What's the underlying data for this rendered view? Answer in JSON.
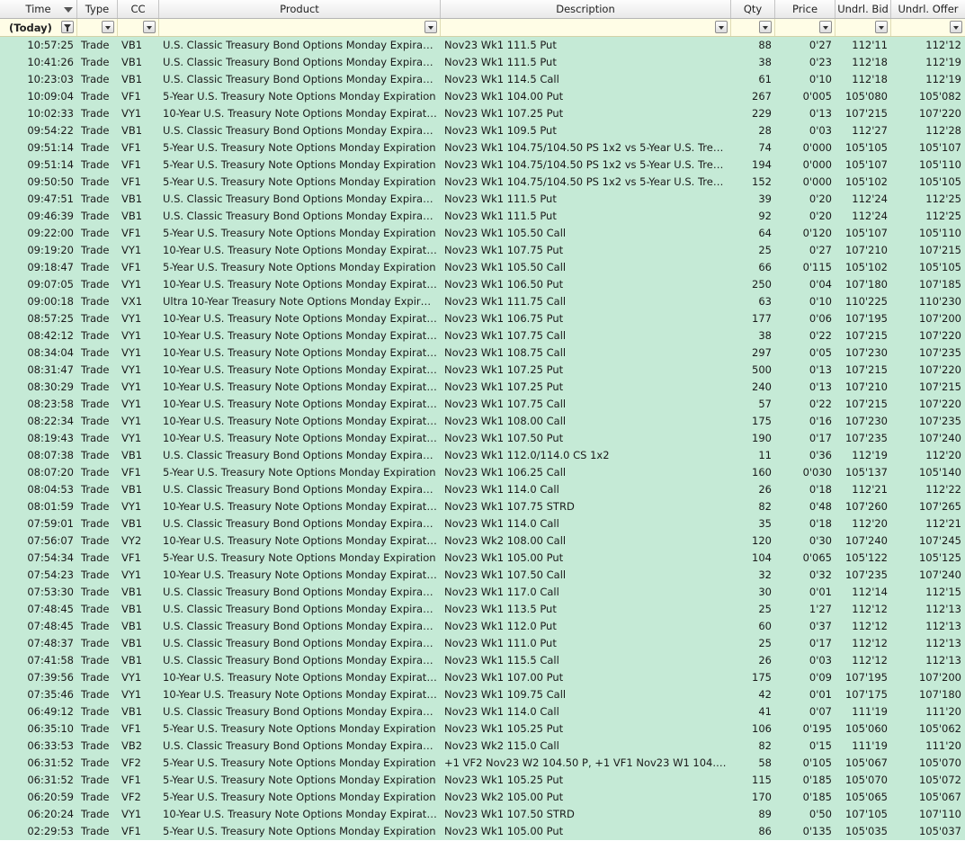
{
  "columns": {
    "time": "Time",
    "type": "Type",
    "cc": "CC",
    "product": "Product",
    "description": "Description",
    "qty": "Qty",
    "price": "Price",
    "undrl_bid": "Undrl. Bid",
    "undrl_offer": "Undrl. Offer"
  },
  "filter": {
    "time": "(Today)"
  },
  "icons": {
    "sort": "sort-descending-icon",
    "filter_dropdown": "chevron-down-icon",
    "filter_active": "funnel-filter-icon"
  },
  "colors": {
    "row_bg": "#c5ead6",
    "filter_bg": "#fffde6"
  },
  "rows": [
    [
      "10:57:25",
      "Trade",
      "VB1",
      "U.S. Classic Treasury Bond Options Monday Expiration",
      "Nov23 Wk1 111.5 Put",
      "88",
      "0'27",
      "112'11",
      "112'12"
    ],
    [
      "10:41:26",
      "Trade",
      "VB1",
      "U.S. Classic Treasury Bond Options Monday Expiration",
      "Nov23 Wk1 111.5 Put",
      "38",
      "0'23",
      "112'18",
      "112'19"
    ],
    [
      "10:23:03",
      "Trade",
      "VB1",
      "U.S. Classic Treasury Bond Options Monday Expiration",
      "Nov23 Wk1 114.5 Call",
      "61",
      "0'10",
      "112'18",
      "112'19"
    ],
    [
      "10:09:04",
      "Trade",
      "VF1",
      "5-Year U.S. Treasury Note Options Monday Expiration",
      "Nov23 Wk1 104.00 Put",
      "267",
      "0'005",
      "105'080",
      "105'082"
    ],
    [
      "10:02:33",
      "Trade",
      "VY1",
      "10-Year U.S. Treasury Note Options Monday Expiration",
      "Nov23 Wk1 107.25 Put",
      "229",
      "0'13",
      "107'215",
      "107'220"
    ],
    [
      "09:54:22",
      "Trade",
      "VB1",
      "U.S. Classic Treasury Bond Options Monday Expiration",
      "Nov23 Wk1 109.5 Put",
      "28",
      "0'03",
      "112'27",
      "112'28"
    ],
    [
      "09:51:14",
      "Trade",
      "VF1",
      "5-Year U.S. Treasury Note Options Monday Expiration",
      "Nov23 Wk1 104.75/104.50 PS 1x2 vs 5-Year U.S. Treasury Note Futures",
      "74",
      "0'000",
      "105'105",
      "105'107"
    ],
    [
      "09:51:14",
      "Trade",
      "VF1",
      "5-Year U.S. Treasury Note Options Monday Expiration",
      "Nov23 Wk1 104.75/104.50 PS 1x2 vs 5-Year U.S. Treasury Note Futures",
      "194",
      "0'000",
      "105'107",
      "105'110"
    ],
    [
      "09:50:50",
      "Trade",
      "VF1",
      "5-Year U.S. Treasury Note Options Monday Expiration",
      "Nov23 Wk1 104.75/104.50 PS 1x2 vs 5-Year U.S. Treasury Note Futures",
      "152",
      "0'000",
      "105'102",
      "105'105"
    ],
    [
      "09:47:51",
      "Trade",
      "VB1",
      "U.S. Classic Treasury Bond Options Monday Expiration",
      "Nov23 Wk1 111.5 Put",
      "39",
      "0'20",
      "112'24",
      "112'25"
    ],
    [
      "09:46:39",
      "Trade",
      "VB1",
      "U.S. Classic Treasury Bond Options Monday Expiration",
      "Nov23 Wk1 111.5 Put",
      "92",
      "0'20",
      "112'24",
      "112'25"
    ],
    [
      "09:22:00",
      "Trade",
      "VF1",
      "5-Year U.S. Treasury Note Options Monday Expiration",
      "Nov23 Wk1 105.50 Call",
      "64",
      "0'120",
      "105'107",
      "105'110"
    ],
    [
      "09:19:20",
      "Trade",
      "VY1",
      "10-Year U.S. Treasury Note Options Monday Expiration",
      "Nov23 Wk1 107.75 Put",
      "25",
      "0'27",
      "107'210",
      "107'215"
    ],
    [
      "09:18:47",
      "Trade",
      "VF1",
      "5-Year U.S. Treasury Note Options Monday Expiration",
      "Nov23 Wk1 105.50 Call",
      "66",
      "0'115",
      "105'102",
      "105'105"
    ],
    [
      "09:07:05",
      "Trade",
      "VY1",
      "10-Year U.S. Treasury Note Options Monday Expiration",
      "Nov23 Wk1 106.50 Put",
      "250",
      "0'04",
      "107'180",
      "107'185"
    ],
    [
      "09:00:18",
      "Trade",
      "VX1",
      "Ultra 10-Year Treasury Note Options Monday Expiration",
      "Nov23 Wk1 111.75 Call",
      "63",
      "0'10",
      "110'225",
      "110'230"
    ],
    [
      "08:57:25",
      "Trade",
      "VY1",
      "10-Year U.S. Treasury Note Options Monday Expiration",
      "Nov23 Wk1 106.75 Put",
      "177",
      "0'06",
      "107'195",
      "107'200"
    ],
    [
      "08:42:12",
      "Trade",
      "VY1",
      "10-Year U.S. Treasury Note Options Monday Expiration",
      "Nov23 Wk1 107.75 Call",
      "38",
      "0'22",
      "107'215",
      "107'220"
    ],
    [
      "08:34:04",
      "Trade",
      "VY1",
      "10-Year U.S. Treasury Note Options Monday Expiration",
      "Nov23 Wk1 108.75 Call",
      "297",
      "0'05",
      "107'230",
      "107'235"
    ],
    [
      "08:31:47",
      "Trade",
      "VY1",
      "10-Year U.S. Treasury Note Options Monday Expiration",
      "Nov23 Wk1 107.25 Put",
      "500",
      "0'13",
      "107'215",
      "107'220"
    ],
    [
      "08:30:29",
      "Trade",
      "VY1",
      "10-Year U.S. Treasury Note Options Monday Expiration",
      "Nov23 Wk1 107.25 Put",
      "240",
      "0'13",
      "107'210",
      "107'215"
    ],
    [
      "08:23:58",
      "Trade",
      "VY1",
      "10-Year U.S. Treasury Note Options Monday Expiration",
      "Nov23 Wk1 107.75 Call",
      "57",
      "0'22",
      "107'215",
      "107'220"
    ],
    [
      "08:22:34",
      "Trade",
      "VY1",
      "10-Year U.S. Treasury Note Options Monday Expiration",
      "Nov23 Wk1 108.00 Call",
      "175",
      "0'16",
      "107'230",
      "107'235"
    ],
    [
      "08:19:43",
      "Trade",
      "VY1",
      "10-Year U.S. Treasury Note Options Monday Expiration",
      "Nov23 Wk1 107.50 Put",
      "190",
      "0'17",
      "107'235",
      "107'240"
    ],
    [
      "08:07:38",
      "Trade",
      "VB1",
      "U.S. Classic Treasury Bond Options Monday Expiration",
      "Nov23 Wk1 112.0/114.0 CS 1x2",
      "11",
      "0'36",
      "112'19",
      "112'20"
    ],
    [
      "08:07:20",
      "Trade",
      "VF1",
      "5-Year U.S. Treasury Note Options Monday Expiration",
      "Nov23 Wk1 106.25 Call",
      "160",
      "0'030",
      "105'137",
      "105'140"
    ],
    [
      "08:04:53",
      "Trade",
      "VB1",
      "U.S. Classic Treasury Bond Options Monday Expiration",
      "Nov23 Wk1 114.0 Call",
      "26",
      "0'18",
      "112'21",
      "112'22"
    ],
    [
      "08:01:59",
      "Trade",
      "VY1",
      "10-Year U.S. Treasury Note Options Monday Expiration",
      "Nov23 Wk1 107.75 STRD",
      "82",
      "0'48",
      "107'260",
      "107'265"
    ],
    [
      "07:59:01",
      "Trade",
      "VB1",
      "U.S. Classic Treasury Bond Options Monday Expiration",
      "Nov23 Wk1 114.0 Call",
      "35",
      "0'18",
      "112'20",
      "112'21"
    ],
    [
      "07:56:07",
      "Trade",
      "VY2",
      "10-Year U.S. Treasury Note Options Monday Expiration",
      "Nov23 Wk2 108.00 Call",
      "120",
      "0'30",
      "107'240",
      "107'245"
    ],
    [
      "07:54:34",
      "Trade",
      "VF1",
      "5-Year U.S. Treasury Note Options Monday Expiration",
      "Nov23 Wk1 105.00 Put",
      "104",
      "0'065",
      "105'122",
      "105'125"
    ],
    [
      "07:54:23",
      "Trade",
      "VY1",
      "10-Year U.S. Treasury Note Options Monday Expiration",
      "Nov23 Wk1 107.50 Call",
      "32",
      "0'32",
      "107'235",
      "107'240"
    ],
    [
      "07:53:30",
      "Trade",
      "VB1",
      "U.S. Classic Treasury Bond Options Monday Expiration",
      "Nov23 Wk1 117.0 Call",
      "30",
      "0'01",
      "112'14",
      "112'15"
    ],
    [
      "07:48:45",
      "Trade",
      "VB1",
      "U.S. Classic Treasury Bond Options Monday Expiration",
      "Nov23 Wk1 113.5 Put",
      "25",
      "1'27",
      "112'12",
      "112'13"
    ],
    [
      "07:48:45",
      "Trade",
      "VB1",
      "U.S. Classic Treasury Bond Options Monday Expiration",
      "Nov23 Wk1 112.0 Put",
      "60",
      "0'37",
      "112'12",
      "112'13"
    ],
    [
      "07:48:37",
      "Trade",
      "VB1",
      "U.S. Classic Treasury Bond Options Monday Expiration",
      "Nov23 Wk1 111.0 Put",
      "25",
      "0'17",
      "112'12",
      "112'13"
    ],
    [
      "07:41:58",
      "Trade",
      "VB1",
      "U.S. Classic Treasury Bond Options Monday Expiration",
      "Nov23 Wk1 115.5 Call",
      "26",
      "0'03",
      "112'12",
      "112'13"
    ],
    [
      "07:39:56",
      "Trade",
      "VY1",
      "10-Year U.S. Treasury Note Options Monday Expiration",
      "Nov23 Wk1 107.00 Put",
      "175",
      "0'09",
      "107'195",
      "107'200"
    ],
    [
      "07:35:46",
      "Trade",
      "VY1",
      "10-Year U.S. Treasury Note Options Monday Expiration",
      "Nov23 Wk1 109.75 Call",
      "42",
      "0'01",
      "107'175",
      "107'180"
    ],
    [
      "06:49:12",
      "Trade",
      "VB1",
      "U.S. Classic Treasury Bond Options Monday Expiration",
      "Nov23 Wk1 114.0 Call",
      "41",
      "0'07",
      "111'19",
      "111'20"
    ],
    [
      "06:35:10",
      "Trade",
      "VF1",
      "5-Year U.S. Treasury Note Options Monday Expiration",
      "Nov23 Wk1 105.25 Put",
      "106",
      "0'195",
      "105'060",
      "105'062"
    ],
    [
      "06:33:53",
      "Trade",
      "VB2",
      "U.S. Classic Treasury Bond Options Monday Expiration",
      "Nov23 Wk2 115.0 Call",
      "82",
      "0'15",
      "111'19",
      "111'20"
    ],
    [
      "06:31:52",
      "Trade",
      "VF2",
      "5-Year U.S. Treasury Note Options Monday Expiration",
      "+1 VF2 Nov23 W2 104.50 P, +1 VF1 Nov23 W1 104.50 P",
      "58",
      "0'105",
      "105'067",
      "105'070"
    ],
    [
      "06:31:52",
      "Trade",
      "VF1",
      "5-Year U.S. Treasury Note Options Monday Expiration",
      "Nov23 Wk1 105.25 Put",
      "115",
      "0'185",
      "105'070",
      "105'072"
    ],
    [
      "06:20:59",
      "Trade",
      "VF2",
      "5-Year U.S. Treasury Note Options Monday Expiration",
      "Nov23 Wk2 105.00 Put",
      "170",
      "0'185",
      "105'065",
      "105'067"
    ],
    [
      "06:20:24",
      "Trade",
      "VY1",
      "10-Year U.S. Treasury Note Options Monday Expiration",
      "Nov23 Wk1 107.50 STRD",
      "89",
      "0'50",
      "107'105",
      "107'110"
    ],
    [
      "02:29:53",
      "Trade",
      "VF1",
      "5-Year U.S. Treasury Note Options Monday Expiration",
      "Nov23 Wk1 105.00 Put",
      "86",
      "0'135",
      "105'035",
      "105'037"
    ]
  ]
}
